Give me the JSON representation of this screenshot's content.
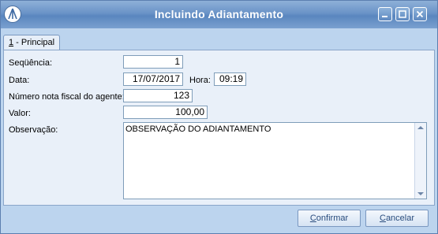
{
  "window": {
    "title": "Incluindo Adiantamento",
    "icons": {
      "app": "app-logo-icon",
      "minimize": "minimize-icon",
      "maximize": "maximize-icon",
      "close": "close-icon"
    }
  },
  "tabs": [
    {
      "hotkey": "1",
      "label_rest": " - Principal",
      "selected": true
    }
  ],
  "form": {
    "sequencia_label": "Seqüência:",
    "sequencia_value": "1",
    "data_label": "Data:",
    "data_value": "17/07/2017",
    "hora_label": "Hora:",
    "hora_value": "09:19",
    "nota_label": "Número nota fiscal do agente:",
    "nota_value": "123",
    "valor_label": "Valor:",
    "valor_value": "100,00",
    "observacao_label": "Observação:",
    "observacao_value": "OBSERVAÇÃO DO ADIANTAMENTO"
  },
  "buttons": {
    "confirmar_hotkey": "C",
    "confirmar_rest": "onfirmar",
    "cancelar_hotkey": "C",
    "cancelar_rest": "ancelar"
  },
  "colors": {
    "title_bar": "#6a93c7",
    "window_bg": "#bcd4ee",
    "panel_bg": "#e9f0f9",
    "field_border": "#7f9db9"
  }
}
